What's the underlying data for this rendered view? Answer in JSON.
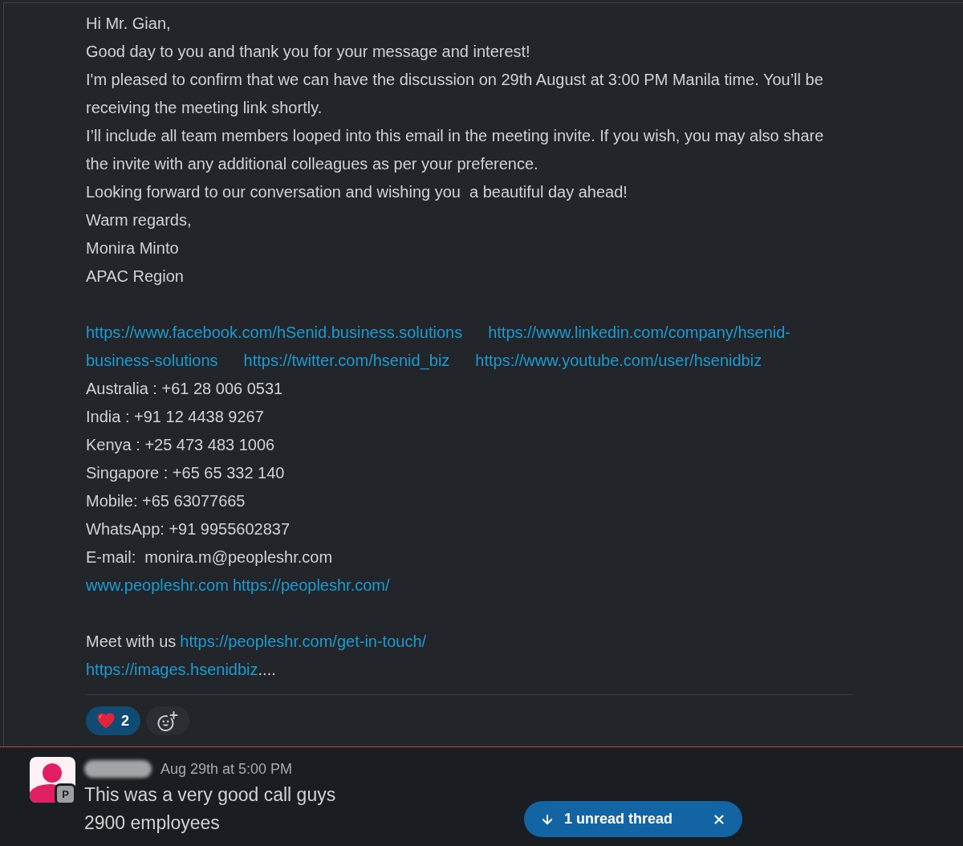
{
  "message": {
    "sections": [
      {
        "lines": [
          {
            "kind": "text",
            "text": "Hi Mr. Gian,"
          },
          {
            "kind": "text",
            "text": "Good day to you and thank you for your message and interest!"
          },
          {
            "kind": "text",
            "text": "I'm pleased to confirm that we can have the discussion on 29th August at 3:00 PM Manila time. You’ll be receiving the meeting link shortly."
          },
          {
            "kind": "text",
            "text": "I’ll include all team members looped into this email in the meeting invite. If you wish, you may also share the invite with any additional colleagues as per your preference."
          },
          {
            "kind": "text",
            "text": "Looking forward to our conversation and wishing you  a beautiful day ahead!"
          },
          {
            "kind": "text",
            "text": "Warm regards,"
          },
          {
            "kind": "text",
            "text": "Monira Minto"
          },
          {
            "kind": "text",
            "text": "APAC Region"
          }
        ]
      },
      {
        "lines": [
          {
            "kind": "social_links",
            "links": [
              "https://www.facebook.com/hSenid.business.solutions",
              "https://www.linkedin.com/company/hsenid-",
              "business-solutions",
              "https://twitter.com/hsenid_biz",
              "https://www.youtube.com/user/hsenidbiz"
            ]
          },
          {
            "kind": "text",
            "text": "Australia : +61 28 006 0531"
          },
          {
            "kind": "text",
            "text": "India : +91 12 4438 9267"
          },
          {
            "kind": "text",
            "text": "Kenya : +25 473 483 1006"
          },
          {
            "kind": "text",
            "text": "Singapore : +65 65 332 140"
          },
          {
            "kind": "text",
            "text": "Mobile: +65 63077665"
          },
          {
            "kind": "text",
            "text": "WhatsApp: +91 9955602837"
          },
          {
            "kind": "text",
            "text": "E-mail:  monira.m@peopleshr.com"
          },
          {
            "kind": "web_links",
            "links": [
              "www.peopleshr.com",
              "https://peopleshr.com/"
            ]
          }
        ]
      },
      {
        "lines": [
          {
            "kind": "labeled_link",
            "label": "Meet with us",
            "link": "https://peopleshr.com/get-in-touch/"
          },
          {
            "kind": "truncated_link",
            "link": "https://images.hsenidbiz",
            "suffix": "...."
          }
        ]
      }
    ],
    "reactions": [
      {
        "count": "2",
        "selected": true
      }
    ]
  },
  "next_message": {
    "timestamp": "Aug 29th at 5:00 PM",
    "avatar_badge": "P",
    "lines": [
      "This was a very good call guys",
      "2900 employees"
    ]
  },
  "unread_banner": {
    "label": "1 unread thread"
  }
}
